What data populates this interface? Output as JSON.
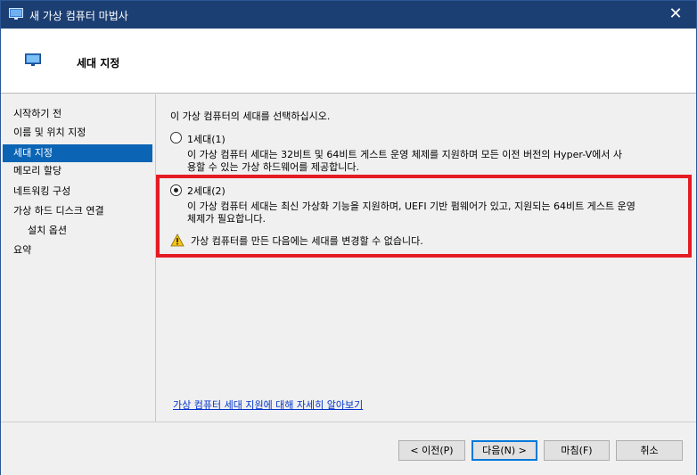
{
  "window": {
    "title": "새 가상 컴퓨터 마법사",
    "close_glyph": "✕"
  },
  "header": {
    "title": "세대 지정",
    "icon": "monitor-icon"
  },
  "sidebar": {
    "items": [
      {
        "label": "시작하기 전"
      },
      {
        "label": "이름 및 위치 지정"
      },
      {
        "label": "세대 지정"
      },
      {
        "label": "메모리 할당"
      },
      {
        "label": "네트워킹 구성"
      },
      {
        "label": "가상 하드 디스크 연결"
      },
      {
        "label": "설치 옵션"
      },
      {
        "label": "요약"
      }
    ],
    "selected_index": 2
  },
  "main": {
    "instruction": "이 가상 컴퓨터의 세대를 선택하십시오.",
    "options": [
      {
        "label": "1세대(1)",
        "description_line1": "이 가상 컴퓨터 세대는 32비트 및 64비트 게스트 운영 체제를 지원하며 모든 이전 버전의 Hyper-V에서 사",
        "description_line2": "용할 수 있는 가상 하드웨어를 제공합니다.",
        "selected": false
      },
      {
        "label": "2세대(2)",
        "description_line1": "이 가상 컴퓨터 세대는 최신 가상화 기능을 지원하며, UEFI 기반 펌웨어가 있고, 지원되는 64비트 게스트 운영",
        "description_line2": "체제가 필요합니다.",
        "selected": true
      }
    ],
    "warning": "가상 컴퓨터를 만든 다음에는 세대를 변경할 수 없습니다.",
    "learn_more_link": "가상 컴퓨터 세대 지원에 대해 자세히 알아보기"
  },
  "footer": {
    "prev_label": "< 이전(P)",
    "next_label": "다음(N) >",
    "finish_label": "마침(F)",
    "cancel_label": "취소"
  },
  "colors": {
    "titlebar": "#1c3f73",
    "selection": "#0c64b4",
    "highlight_box": "#e41b23",
    "link": "#0033cc"
  }
}
